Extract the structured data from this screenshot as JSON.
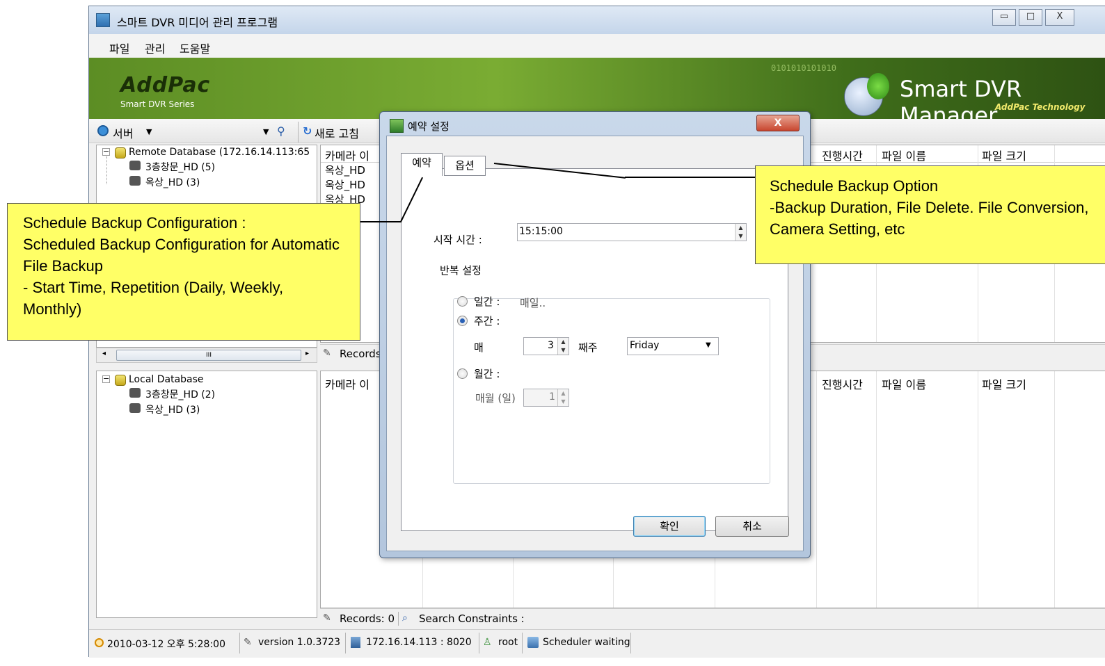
{
  "window": {
    "title": "스마트 DVR 미디어 관리 프로그램",
    "controls": [
      "▭",
      "□",
      "X"
    ]
  },
  "menu": [
    "파일",
    "관리",
    "도움말"
  ],
  "banner": {
    "brand": "AddPac",
    "brand_sub": "Smart DVR Series",
    "product": "Smart DVR Manager",
    "product_sub": "AddPac Technology",
    "binary": "0101010101010"
  },
  "toolbar": {
    "server_label": "서버",
    "refresh_label": "새로 고침"
  },
  "remote_tree": {
    "root": "Remote Database (172.16.14.113:65",
    "children": [
      "3층창문_HD (5)",
      "옥상_HD (3)"
    ]
  },
  "local_tree": {
    "root": "Local Database",
    "children": [
      "3층창문_HD (2)",
      "옥상_HD (3)"
    ]
  },
  "upper_grid": {
    "headers": [
      "카메라 이",
      "진행시간",
      "파일 이름",
      "파일 크기"
    ],
    "rows": [
      "옥상_HD",
      "옥상_HD",
      "옥상_HD"
    ],
    "records_label": "Records"
  },
  "lower_grid": {
    "headers": [
      "카메라 이",
      "진행시간",
      "파일 이름",
      "파일 크기"
    ],
    "records_label": "Records: 0",
    "search_label": "Search Constraints :"
  },
  "scroll": {
    "thumb": "III"
  },
  "status": {
    "datetime": "2010-03-12 오후 5:28:00",
    "version": "version 1.0.3723",
    "address": "172.16.14.113 : 8020",
    "user": "root",
    "scheduler": "Scheduler waiting"
  },
  "dialog": {
    "title": "예약 설정",
    "close": "X",
    "tabs": [
      "예약",
      "옵션"
    ],
    "start_time_label": "시작 시간 :",
    "start_time_value": "15:15:00",
    "repeat_group": "반복 설정",
    "daily_label": "일간 :",
    "daily_value": "매일..",
    "weekly_label": "주간 :",
    "weekly_every": "매",
    "weekly_num": "3",
    "weekly_suffix": "째주",
    "weekly_day": "Friday",
    "monthly_label": "월간 :",
    "monthly_every": "매월 (일)",
    "monthly_num": "1",
    "ok": "확인",
    "cancel": "취소",
    "selected_repeat": "weekly"
  },
  "callouts": {
    "left": "Schedule Backup Configuration :\nScheduled Backup Configuration for Automatic File Backup\n- Start Time, Repetition (Daily, Weekly, Monthly)",
    "right": "Schedule Backup Option\n-Backup Duration, File Delete. File Conversion, Camera Setting, etc"
  },
  "colors": {
    "callout": "#ffff66",
    "banner": "#6a9a2a"
  }
}
